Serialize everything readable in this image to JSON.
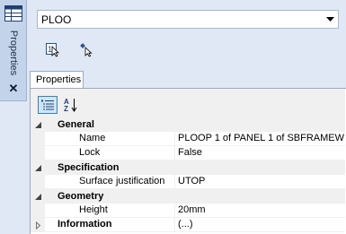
{
  "dock": {
    "label": "Properties",
    "close_glyph": "✕",
    "icon": "properties-grid-icon"
  },
  "combo": {
    "value": "PLOO",
    "arrow_icon": "chevron-down-icon"
  },
  "toolbar": {
    "buttons": [
      {
        "icon": "select-single-icon"
      },
      {
        "icon": "pick-element-icon"
      }
    ]
  },
  "tab": {
    "label": "Properties"
  },
  "prop_toolbar": {
    "categorized_icon": "categorized-view-icon",
    "alphabetical_icon": "sort-alphabetical-icon"
  },
  "grid": {
    "categories": [
      {
        "label": "General",
        "expanded": true,
        "properties": [
          {
            "name": "Name",
            "value": "PLOOP 1 of PANEL 1 of SBFRAMEW"
          },
          {
            "name": "Lock",
            "value": "False"
          }
        ]
      },
      {
        "label": "Specification",
        "expanded": true,
        "properties": [
          {
            "name": "Surface justification",
            "value": "UTOP"
          }
        ]
      },
      {
        "label": "Geometry",
        "expanded": true,
        "properties": [
          {
            "name": "Height",
            "value": "20mm"
          }
        ]
      },
      {
        "label": "Information",
        "expanded": false,
        "collapsed_value": "(...)",
        "properties": []
      }
    ]
  }
}
